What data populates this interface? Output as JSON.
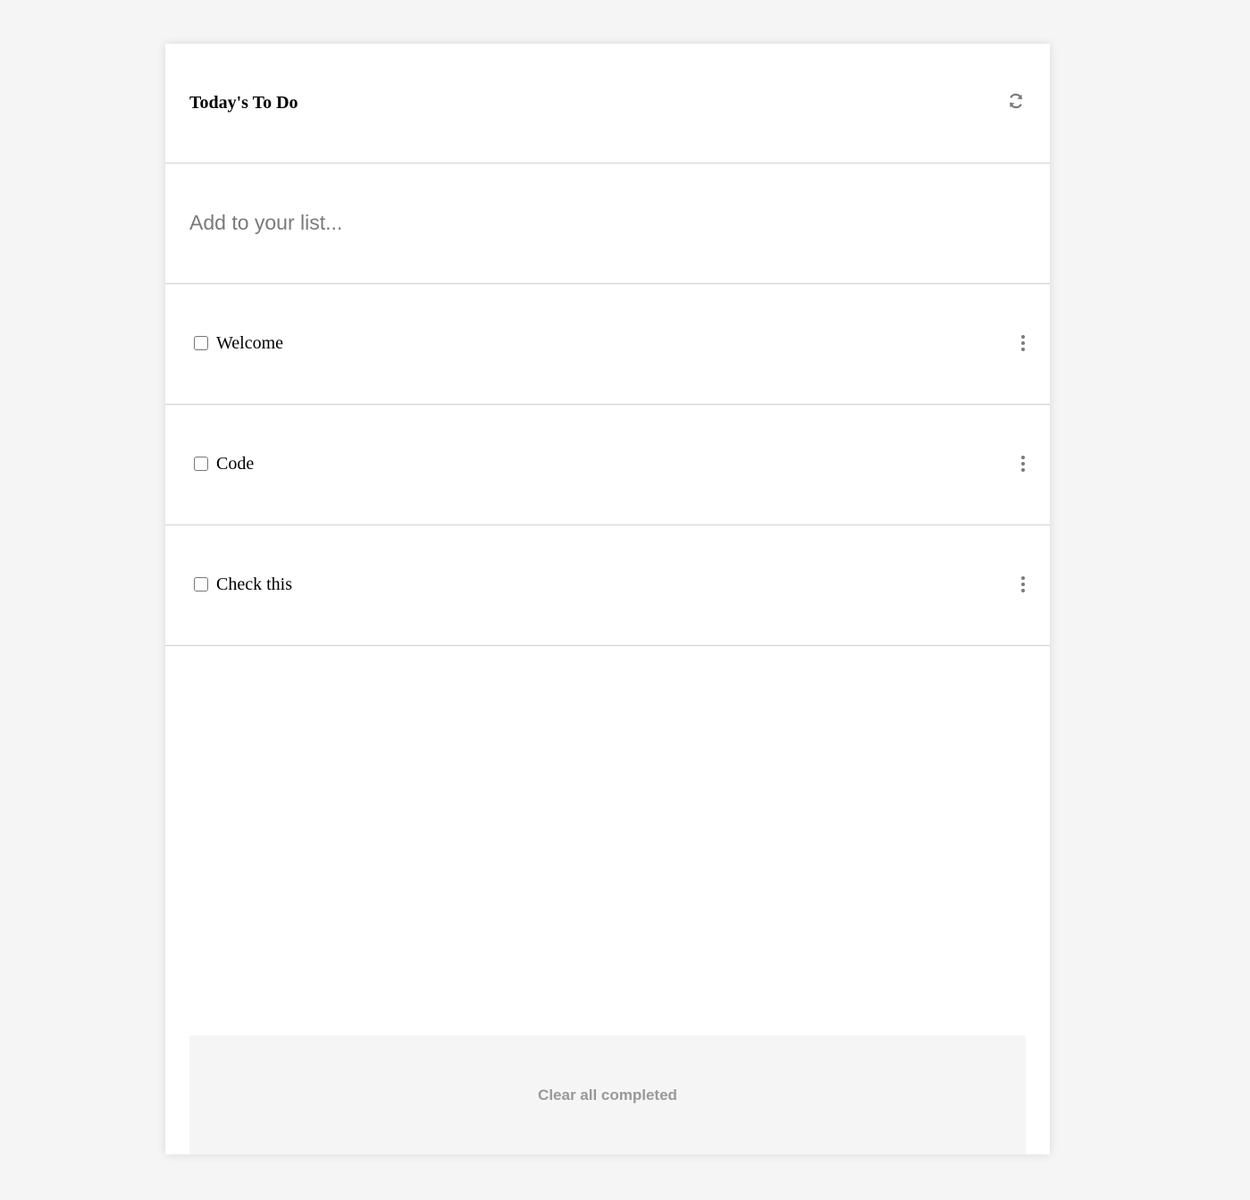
{
  "header": {
    "title": "Today's To Do",
    "refresh_icon": "refresh-icon"
  },
  "add_input": {
    "placeholder": "Add to your list...",
    "value": ""
  },
  "todos": [
    {
      "label": "Welcome",
      "checked": false,
      "menu_icon": "kebab-menu-icon"
    },
    {
      "label": "Code",
      "checked": false,
      "menu_icon": "kebab-menu-icon"
    },
    {
      "label": "Check this",
      "checked": false,
      "menu_icon": "kebab-menu-icon"
    }
  ],
  "footer": {
    "clear_label": "Clear all completed"
  },
  "colors": {
    "page_background": "#f5f5f5",
    "card_background": "#ffffff",
    "divider": "#cfcfcf",
    "muted_text": "#999999",
    "icon": "#7a7a7a"
  }
}
